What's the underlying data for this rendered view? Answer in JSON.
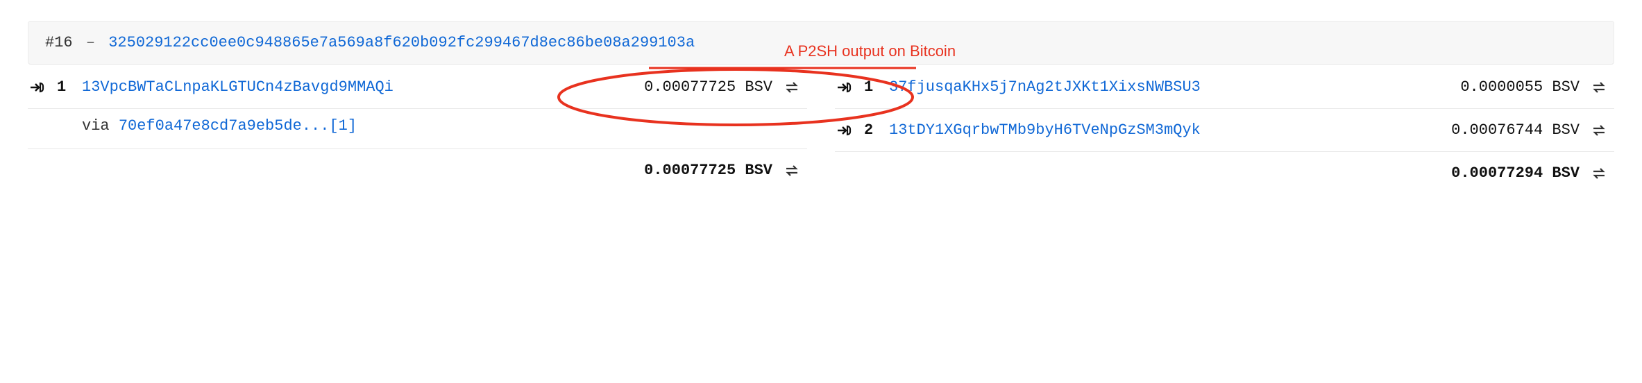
{
  "tx": {
    "index_label": "#16",
    "dash": "–",
    "hash": "325029122cc0ee0c948865e7a569a8f620b092fc299467d8ec86be08a299103a"
  },
  "inputs": [
    {
      "n": "1",
      "address": "13VpcBWTaCLnpaKLGTUCn4zBavgd9MMAQi",
      "amount": "0.00077725 BSV",
      "via_prefix": "via",
      "via_link": "70ef0a47e8cd7a9eb5de...[1]"
    }
  ],
  "input_total": "0.00077725 BSV",
  "outputs": [
    {
      "n": "1",
      "address": "37fjusqaKHx5j7nAg2tJXKt1XixsNWBSU3",
      "amount": "0.0000055 BSV"
    },
    {
      "n": "2",
      "address": "13tDY1XGqrbwTMb9byH6TVeNpGzSM3mQyk",
      "amount": "0.00076744 BSV"
    }
  ],
  "output_total": "0.00077294 BSV",
  "annotation": {
    "label": "A P2SH output on Bitcoin"
  }
}
